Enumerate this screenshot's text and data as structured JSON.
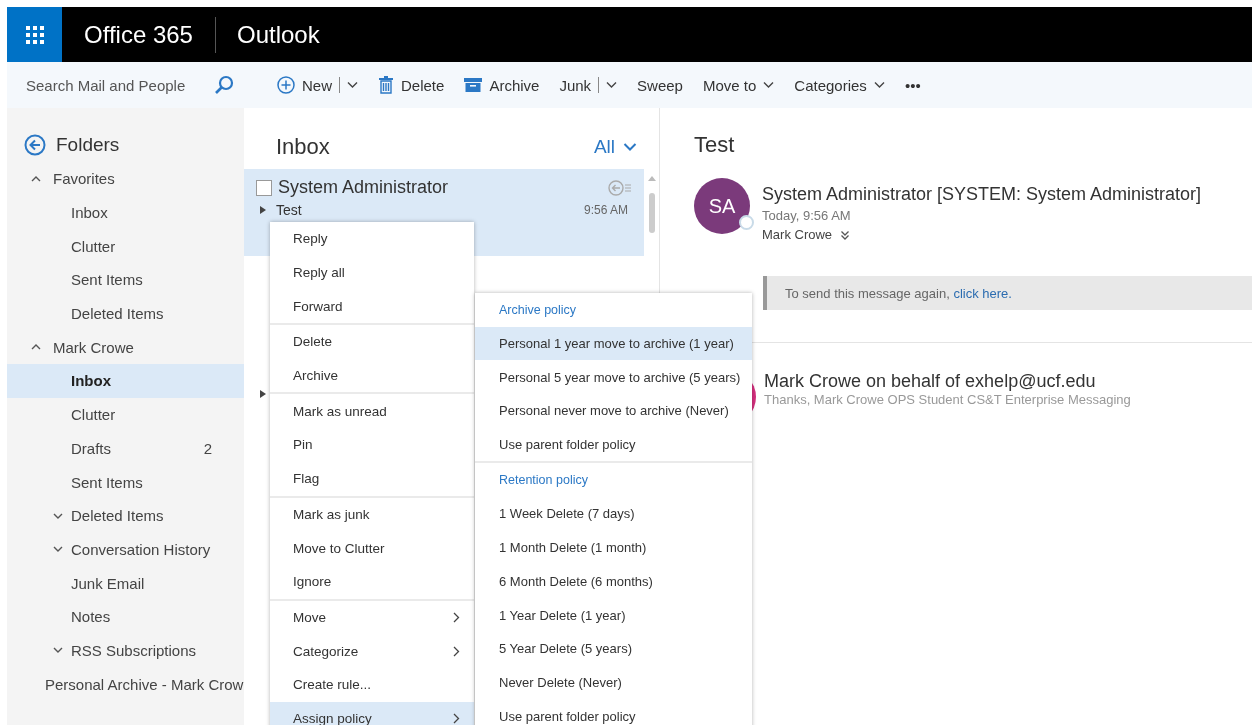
{
  "app_bar": {
    "suite": "Office 365",
    "app": "Outlook"
  },
  "search": {
    "placeholder": "Search Mail and People"
  },
  "toolbar": [
    {
      "label": "New",
      "kind": "new"
    },
    {
      "label": "Delete",
      "kind": "delete"
    },
    {
      "label": "Archive",
      "kind": "archive"
    },
    {
      "label": "Junk",
      "kind": "split"
    },
    {
      "label": "Sweep",
      "kind": "plain"
    },
    {
      "label": "Move to",
      "kind": "dropdown"
    },
    {
      "label": "Categories",
      "kind": "dropdown"
    },
    {
      "label": "•••",
      "kind": "plain"
    }
  ],
  "folders": {
    "title": "Folders",
    "tree": [
      {
        "label": "Favorites",
        "expanded": true,
        "selected": false,
        "children": [
          {
            "label": "Inbox",
            "selected": false
          },
          {
            "label": "Clutter",
            "selected": false
          },
          {
            "label": "Sent Items",
            "selected": false
          },
          {
            "label": "Deleted Items",
            "selected": false
          }
        ]
      },
      {
        "label": "Mark Crowe",
        "expanded": true,
        "selected": false,
        "children": [
          {
            "label": "Inbox",
            "selected": true
          },
          {
            "label": "Clutter",
            "selected": false
          },
          {
            "label": "Drafts",
            "count": "2",
            "selected": false
          },
          {
            "label": "Sent Items",
            "selected": false
          },
          {
            "label": "Deleted Items",
            "expanded": false,
            "selected": false
          },
          {
            "label": "Conversation History",
            "expanded": false,
            "selected": false
          },
          {
            "label": "Junk Email",
            "selected": false
          },
          {
            "label": "Notes",
            "selected": false
          },
          {
            "label": "RSS Subscriptions",
            "expanded": false,
            "selected": false
          }
        ]
      },
      {
        "label": "Personal Archive - Mark Crow",
        "selected": false
      }
    ]
  },
  "message_list": {
    "title": "Inbox",
    "filter": "All",
    "messages": [
      {
        "sender": "System Administrator",
        "subject": "Test",
        "time": "9:56 AM",
        "selected": true,
        "checked": false
      }
    ]
  },
  "context_menu": {
    "groups": [
      [
        {
          "label": "Reply",
          "selected": false
        },
        {
          "label": "Reply all",
          "selected": false
        },
        {
          "label": "Forward",
          "selected": false
        }
      ],
      [
        {
          "label": "Delete",
          "selected": false
        },
        {
          "label": "Archive",
          "selected": false
        }
      ],
      [
        {
          "label": "Mark as unread",
          "selected": false
        },
        {
          "label": "Pin",
          "selected": false
        },
        {
          "label": "Flag",
          "selected": false
        }
      ],
      [
        {
          "label": "Mark as junk",
          "selected": false
        },
        {
          "label": "Move to Clutter",
          "selected": false
        },
        {
          "label": "Ignore",
          "selected": false
        }
      ],
      [
        {
          "label": "Move",
          "submenu": true,
          "selected": false
        },
        {
          "label": "Categorize",
          "submenu": true,
          "selected": false
        },
        {
          "label": "Create rule...",
          "selected": false
        },
        {
          "label": "Assign policy",
          "submenu": true,
          "selected": true
        }
      ]
    ]
  },
  "policy_menu": {
    "sections": [
      {
        "heading": "Archive policy",
        "items": [
          {
            "label": "Personal 1 year move to archive (1 year)",
            "selected": true
          },
          {
            "label": "Personal 5 year move to archive (5 years)",
            "selected": false
          },
          {
            "label": "Personal never move to archive (Never)",
            "selected": false
          },
          {
            "label": "Use parent folder policy",
            "selected": false
          }
        ]
      },
      {
        "heading": "Retention policy",
        "items": [
          {
            "label": "1 Week Delete (7 days)",
            "selected": false
          },
          {
            "label": "1 Month Delete (1 month)",
            "selected": false
          },
          {
            "label": "6 Month Delete (6 months)",
            "selected": false
          },
          {
            "label": "1 Year Delete (1 year)",
            "selected": false
          },
          {
            "label": "5 Year Delete (5 years)",
            "selected": false
          },
          {
            "label": "Never Delete (Never)",
            "selected": false
          },
          {
            "label": "Use parent folder policy",
            "selected": false
          }
        ]
      }
    ]
  },
  "reading_pane": {
    "subject": "Test",
    "message": {
      "initials": "SA",
      "color": "#7b3a7b",
      "sender": "System Administrator [SYSTEM: System Administrator]",
      "time": "Today, 9:56 AM",
      "to": "Mark Crowe"
    },
    "notice": {
      "text": "To send this message again, ",
      "link": "click here."
    },
    "reply": {
      "color": "#d6307f",
      "sender": "Mark Crowe on behalf of exhelp@ucf.edu",
      "preview": "Thanks, Mark Crowe OPS Student CS&T Enterprise Messaging"
    }
  }
}
